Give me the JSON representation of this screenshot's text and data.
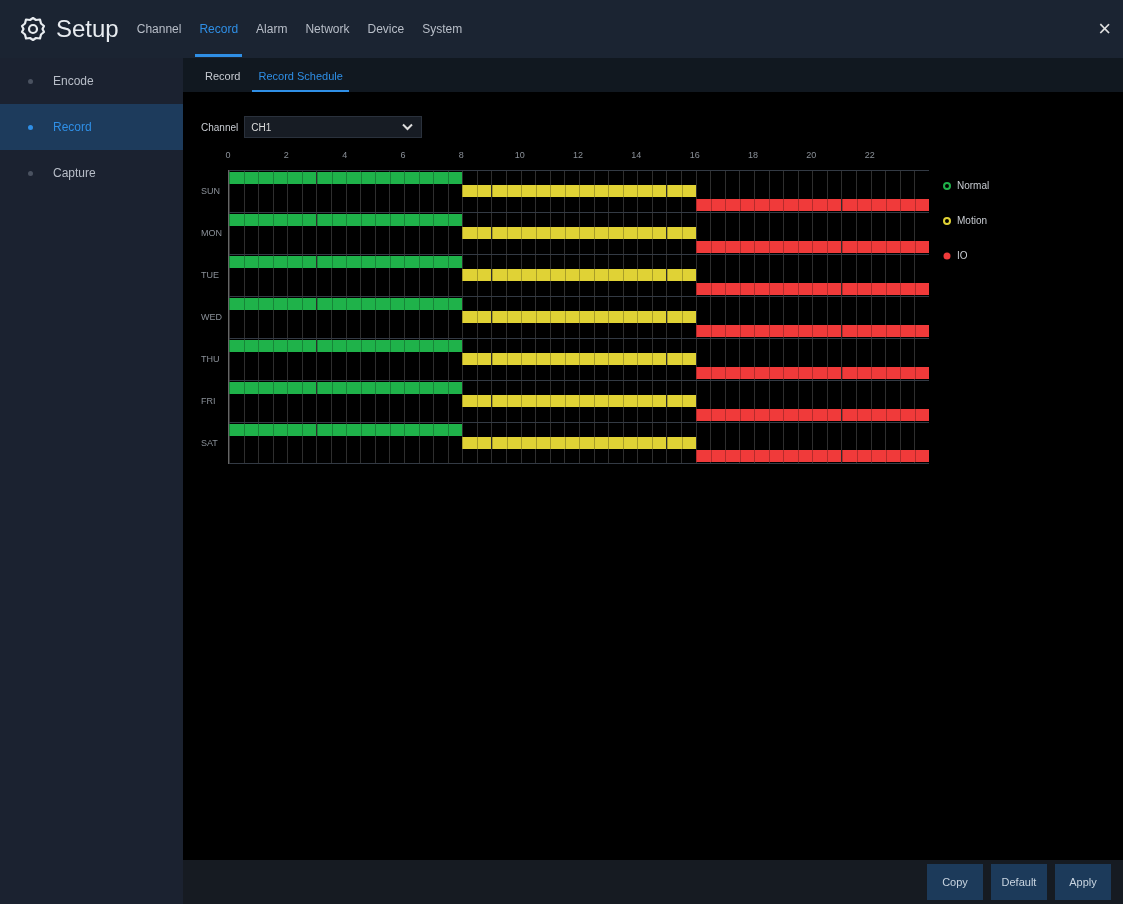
{
  "header": {
    "title": "Setup",
    "close": "×",
    "tabs": [
      {
        "label": "Channel",
        "selected": false
      },
      {
        "label": "Record",
        "selected": true
      },
      {
        "label": "Alarm",
        "selected": false
      },
      {
        "label": "Network",
        "selected": false
      },
      {
        "label": "Device",
        "selected": false
      },
      {
        "label": "System",
        "selected": false
      }
    ]
  },
  "sidebar": {
    "items": [
      {
        "label": "Encode",
        "selected": false
      },
      {
        "label": "Record",
        "selected": true
      },
      {
        "label": "Capture",
        "selected": false
      }
    ]
  },
  "subtabs": [
    {
      "label": "Record",
      "selected": false
    },
    {
      "label": "Record Schedule",
      "selected": true
    }
  ],
  "channel": {
    "label": "Channel",
    "value": "CH1"
  },
  "schedule": {
    "hour_labels": [
      "0",
      "2",
      "4",
      "6",
      "8",
      "10",
      "12",
      "14",
      "16",
      "18",
      "20",
      "22"
    ],
    "days": [
      {
        "name": "SUN",
        "slots": [
          {
            "kind": "normal"
          },
          {
            "kind": "normal"
          },
          {
            "kind": "normal"
          },
          {
            "kind": "normal"
          },
          {
            "kind": "normal"
          },
          {
            "kind": "normal"
          },
          {
            "kind": "normal"
          },
          {
            "kind": "normal"
          },
          {
            "kind": "motion"
          },
          {
            "kind": "motion"
          },
          {
            "kind": "motion"
          },
          {
            "kind": "motion"
          },
          {
            "kind": "motion"
          },
          {
            "kind": "motion"
          },
          {
            "kind": "motion"
          },
          {
            "kind": "motion"
          },
          {
            "kind": "io"
          },
          {
            "kind": "io"
          },
          {
            "kind": "io"
          },
          {
            "kind": "io"
          },
          {
            "kind": "io"
          },
          {
            "kind": "io"
          },
          {
            "kind": "io"
          },
          {
            "kind": "io"
          }
        ]
      },
      {
        "name": "MON",
        "slots": [
          {
            "kind": "normal"
          },
          {
            "kind": "normal"
          },
          {
            "kind": "normal"
          },
          {
            "kind": "normal"
          },
          {
            "kind": "normal"
          },
          {
            "kind": "normal"
          },
          {
            "kind": "normal"
          },
          {
            "kind": "normal"
          },
          {
            "kind": "motion"
          },
          {
            "kind": "motion"
          },
          {
            "kind": "motion"
          },
          {
            "kind": "motion"
          },
          {
            "kind": "motion"
          },
          {
            "kind": "motion"
          },
          {
            "kind": "motion"
          },
          {
            "kind": "motion"
          },
          {
            "kind": "io"
          },
          {
            "kind": "io"
          },
          {
            "kind": "io"
          },
          {
            "kind": "io"
          },
          {
            "kind": "io"
          },
          {
            "kind": "io"
          },
          {
            "kind": "io"
          },
          {
            "kind": "io"
          }
        ]
      },
      {
        "name": "TUE",
        "slots": [
          {
            "kind": "normal"
          },
          {
            "kind": "normal"
          },
          {
            "kind": "normal"
          },
          {
            "kind": "normal"
          },
          {
            "kind": "normal"
          },
          {
            "kind": "normal"
          },
          {
            "kind": "normal"
          },
          {
            "kind": "normal"
          },
          {
            "kind": "motion"
          },
          {
            "kind": "motion"
          },
          {
            "kind": "motion"
          },
          {
            "kind": "motion"
          },
          {
            "kind": "motion"
          },
          {
            "kind": "motion"
          },
          {
            "kind": "motion"
          },
          {
            "kind": "motion"
          },
          {
            "kind": "io"
          },
          {
            "kind": "io"
          },
          {
            "kind": "io"
          },
          {
            "kind": "io"
          },
          {
            "kind": "io"
          },
          {
            "kind": "io"
          },
          {
            "kind": "io"
          },
          {
            "kind": "io"
          }
        ]
      },
      {
        "name": "WED",
        "slots": [
          {
            "kind": "normal"
          },
          {
            "kind": "normal"
          },
          {
            "kind": "normal"
          },
          {
            "kind": "normal"
          },
          {
            "kind": "normal"
          },
          {
            "kind": "normal"
          },
          {
            "kind": "normal"
          },
          {
            "kind": "normal"
          },
          {
            "kind": "motion"
          },
          {
            "kind": "motion"
          },
          {
            "kind": "motion"
          },
          {
            "kind": "motion"
          },
          {
            "kind": "motion"
          },
          {
            "kind": "motion"
          },
          {
            "kind": "motion"
          },
          {
            "kind": "motion"
          },
          {
            "kind": "io"
          },
          {
            "kind": "io"
          },
          {
            "kind": "io"
          },
          {
            "kind": "io"
          },
          {
            "kind": "io"
          },
          {
            "kind": "io"
          },
          {
            "kind": "io"
          },
          {
            "kind": "io"
          }
        ]
      },
      {
        "name": "THU",
        "slots": [
          {
            "kind": "normal"
          },
          {
            "kind": "normal"
          },
          {
            "kind": "normal"
          },
          {
            "kind": "normal"
          },
          {
            "kind": "normal"
          },
          {
            "kind": "normal"
          },
          {
            "kind": "normal"
          },
          {
            "kind": "normal"
          },
          {
            "kind": "motion"
          },
          {
            "kind": "motion"
          },
          {
            "kind": "motion"
          },
          {
            "kind": "motion"
          },
          {
            "kind": "motion"
          },
          {
            "kind": "motion"
          },
          {
            "kind": "motion"
          },
          {
            "kind": "motion"
          },
          {
            "kind": "io"
          },
          {
            "kind": "io"
          },
          {
            "kind": "io"
          },
          {
            "kind": "io"
          },
          {
            "kind": "io"
          },
          {
            "kind": "io"
          },
          {
            "kind": "io"
          },
          {
            "kind": "io"
          }
        ]
      },
      {
        "name": "FRI",
        "slots": [
          {
            "kind": "normal"
          },
          {
            "kind": "normal"
          },
          {
            "kind": "normal"
          },
          {
            "kind": "normal"
          },
          {
            "kind": "normal"
          },
          {
            "kind": "normal"
          },
          {
            "kind": "normal"
          },
          {
            "kind": "normal"
          },
          {
            "kind": "motion"
          },
          {
            "kind": "motion"
          },
          {
            "kind": "motion"
          },
          {
            "kind": "motion"
          },
          {
            "kind": "motion"
          },
          {
            "kind": "motion"
          },
          {
            "kind": "motion"
          },
          {
            "kind": "motion"
          },
          {
            "kind": "io"
          },
          {
            "kind": "io"
          },
          {
            "kind": "io"
          },
          {
            "kind": "io"
          },
          {
            "kind": "io"
          },
          {
            "kind": "io"
          },
          {
            "kind": "io"
          },
          {
            "kind": "io"
          }
        ]
      },
      {
        "name": "SAT",
        "slots": [
          {
            "kind": "normal"
          },
          {
            "kind": "normal"
          },
          {
            "kind": "normal"
          },
          {
            "kind": "normal"
          },
          {
            "kind": "normal"
          },
          {
            "kind": "normal"
          },
          {
            "kind": "normal"
          },
          {
            "kind": "normal"
          },
          {
            "kind": "motion"
          },
          {
            "kind": "motion"
          },
          {
            "kind": "motion"
          },
          {
            "kind": "motion"
          },
          {
            "kind": "motion"
          },
          {
            "kind": "motion"
          },
          {
            "kind": "motion"
          },
          {
            "kind": "motion"
          },
          {
            "kind": "io"
          },
          {
            "kind": "io"
          },
          {
            "kind": "io"
          },
          {
            "kind": "io"
          },
          {
            "kind": "io"
          },
          {
            "kind": "io"
          },
          {
            "kind": "io"
          },
          {
            "kind": "io"
          }
        ]
      }
    ]
  },
  "legend": [
    {
      "kind": "normal",
      "label": "Normal",
      "color": "#1fb24a"
    },
    {
      "kind": "motion",
      "label": "Motion",
      "color": "#e0d235"
    },
    {
      "kind": "io",
      "label": "IO",
      "color": "#f03a3a"
    }
  ],
  "buttons": [
    "Copy",
    "Default",
    "Apply"
  ]
}
